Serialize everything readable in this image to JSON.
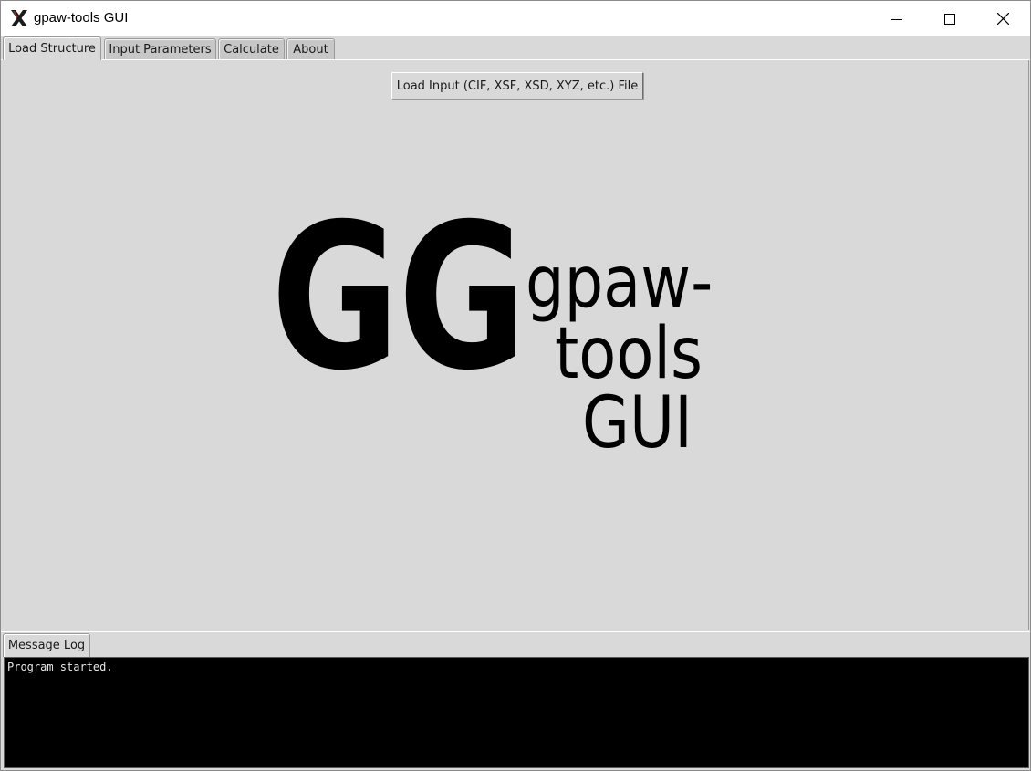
{
  "window": {
    "title": "gpaw-tools GUI",
    "icon": "x-logo-icon",
    "controls": [
      "minimize-icon",
      "maximize-icon",
      "close-icon"
    ]
  },
  "tabs": [
    {
      "label": "Load Structure",
      "active": true
    },
    {
      "label": "Input Parameters",
      "active": false
    },
    {
      "label": "Calculate",
      "active": false
    },
    {
      "label": "About",
      "active": false
    }
  ],
  "main": {
    "load_button": "Load Input (CIF, XSF, XSD, XYZ, etc.) File",
    "logo": {
      "mark": "GG",
      "line1": "gpaw-",
      "line2": "tools",
      "line3": "GUI"
    }
  },
  "log": {
    "tab_label": "Message Log",
    "text": "Program started."
  },
  "colors": {
    "panel": "#d9d9d9",
    "console_bg": "#000000",
    "console_fg": "#e6e6e6"
  }
}
